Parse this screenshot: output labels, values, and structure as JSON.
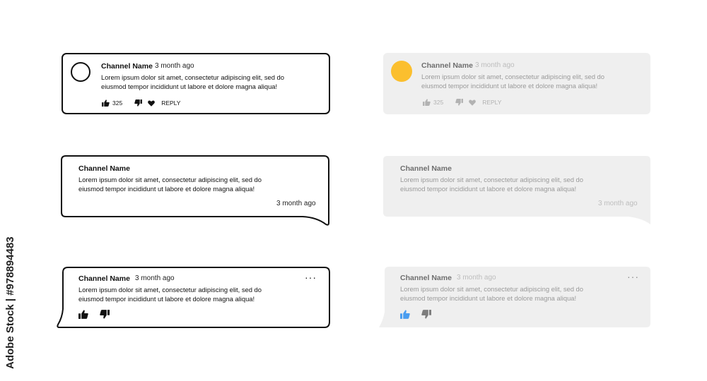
{
  "comments": {
    "channel_name": "Channel Name",
    "time": "3 month ago",
    "text_line1": "Lorem ipsum dolor sit amet, consectetur adipiscing elit, sed do",
    "text_line2": "eiusmod tempor incididunt ut labore et dolore magna aliqua!",
    "likes": "325",
    "reply_label": "REPLY"
  },
  "colors": {
    "outline": "#111111",
    "card_fill": "#efefef",
    "avatar_accent": "#fbbf2e",
    "like_active": "#4a9df0"
  },
  "icons": [
    "thumbs-up-icon",
    "thumbs-down-icon",
    "heart-icon",
    "more-icon"
  ],
  "watermark": {
    "side_text": "Adobe Stock | #978894483"
  }
}
